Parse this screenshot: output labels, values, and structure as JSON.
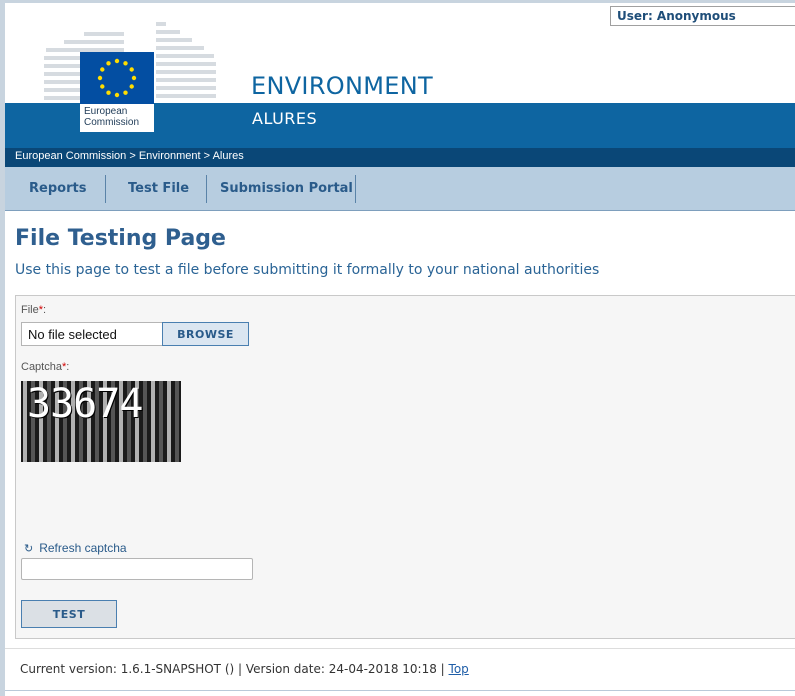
{
  "header": {
    "user_label": "User: Anonymous",
    "site_title": "ENVIRONMENT",
    "site_subtitle": "ALURES",
    "logo_text_line1": "European",
    "logo_text_line2": "Commission"
  },
  "breadcrumb": {
    "items": [
      "European Commission",
      "Environment",
      "Alures"
    ],
    "separator": ">"
  },
  "nav": {
    "items": [
      {
        "label": "Reports"
      },
      {
        "label": "Test File"
      },
      {
        "label": "Submission Portal"
      }
    ]
  },
  "main": {
    "title": "File Testing Page",
    "subtitle": "Use this page to test a file before submitting it formally to your national authorities",
    "file_label": "File",
    "file_value": "No file selected",
    "browse_label": "BROWSE",
    "captcha_label": "Captcha",
    "captcha_text": "33674",
    "refresh_label": "Refresh captcha",
    "required_mark": "*",
    "colon": ":",
    "test_label": "TEST"
  },
  "footer": {
    "version_text": "Current version: 1.6.1-SNAPSHOT () | Version date: 24-04-2018 10:18 |",
    "top_link": "Top"
  },
  "colors": {
    "brand_blue": "#0e65a1",
    "nav_bg": "#b7cde0",
    "link": "#2a5b8a"
  }
}
